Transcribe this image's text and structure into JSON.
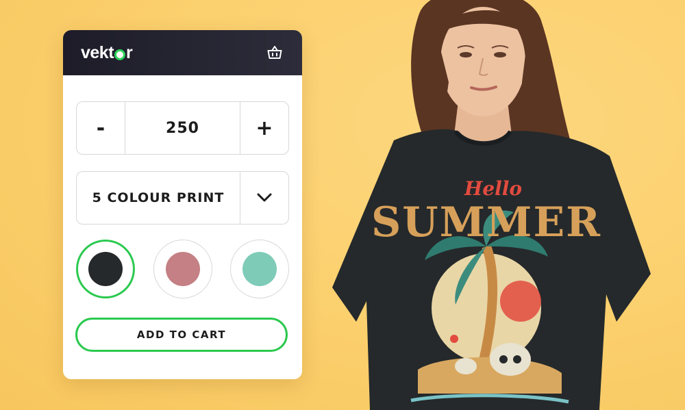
{
  "brand": {
    "name_part1": "vekt",
    "name_part2": "r",
    "accent": "#2bd35a"
  },
  "header": {
    "cart_icon": "shopping-basket-icon"
  },
  "quantity": {
    "minus_label": "-",
    "value": "250",
    "plus_label": "+"
  },
  "print_option": {
    "selected": "5 COLOUR PRINT",
    "chevron_icon": "chevron-down-icon"
  },
  "colors": {
    "swatches": [
      {
        "name": "black",
        "hex": "#25292b",
        "selected": true
      },
      {
        "name": "dusty-rose",
        "hex": "#c48084",
        "selected": false
      },
      {
        "name": "mint",
        "hex": "#7ecbb8",
        "selected": false
      }
    ],
    "selected_ring": "#2bc94f"
  },
  "actions": {
    "add_to_cart_label": "ADD TO CART"
  },
  "shirt_graphic": {
    "line1": "Hello",
    "line2": "SUMMER"
  }
}
